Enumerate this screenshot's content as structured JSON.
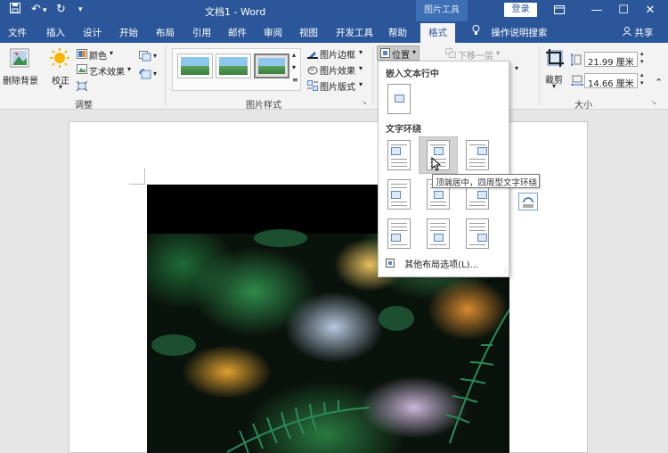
{
  "window": {
    "title": "文档1 - Word",
    "context_tab": "图片工具",
    "login_label": "登录",
    "minimize_glyph": "▭",
    "min_glyph": "—",
    "max_glyph": "☐",
    "close_glyph": "✕"
  },
  "quick_access": {
    "save_icon": "💾",
    "undo_icon": "↶",
    "redo_icon": "↻",
    "customize_icon": "▾"
  },
  "menu": {
    "tabs": [
      "文件",
      "插入",
      "设计",
      "开始",
      "布局",
      "引用",
      "邮件",
      "审阅",
      "视图",
      "开发工具",
      "帮助",
      "格式"
    ],
    "active_tab": "格式",
    "tell_me": "操作说明搜索",
    "share": "共享"
  },
  "ribbon": {
    "adjust": {
      "remove_bg": "删除背景",
      "correct": "校正",
      "color": "颜色",
      "artistic": "艺术效果",
      "label": "调整"
    },
    "styles": {
      "border": "图片边框",
      "effects": "图片效果",
      "layout": "图片版式",
      "label": "图片样式"
    },
    "arrange": {
      "position": "位置",
      "send_back": "下移一层"
    },
    "size": {
      "crop": "裁剪",
      "height": "21.99 厘米",
      "width": "14.66 厘米",
      "label": "大小"
    }
  },
  "dropdown": {
    "inline_header": "嵌入文本行中",
    "wrap_header": "文字环绕",
    "more_options": "其他布局选项(L)...",
    "tooltip": "顶端居中，四周型文字环绕"
  }
}
